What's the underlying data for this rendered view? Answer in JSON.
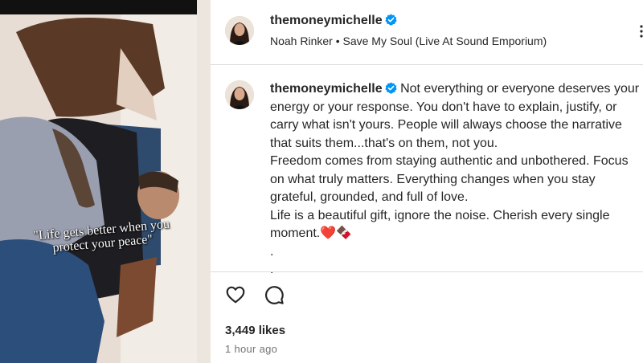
{
  "post": {
    "username": "themoneymichelle",
    "audio_track": "Noah Rinker • Save My Soul (Live At Sound Emporium)",
    "video_overlay_text": "\"Life gets better when you protect your peace\"",
    "caption_lines": [
      "Not everything or everyone deserves your energy or your response. You don't have to explain, justify, or carry what isn't yours. People will always choose the narrative that suits them...that's on them, not you.",
      "Freedom comes from staying authentic and unbothered. Focus on what truly matters. Everything changes when you stay grateful, grounded, and full of love.",
      "Life is a beautiful gift, ignore the noise. Cherish every single moment.",
      ".",
      "."
    ],
    "emojis": "❤️🍫",
    "likes": "3,449 likes",
    "time_ago": "1 hour ago"
  },
  "icons": {
    "verified": "verified-badge-icon",
    "like": "heart-icon",
    "comment": "comment-bubble-icon",
    "more": "more-options-icon"
  },
  "colors": {
    "verified": "#0095f6",
    "text": "#262626",
    "muted": "#737373",
    "divider": "#dbdbdb",
    "heart_emoji": "#e0102b"
  }
}
